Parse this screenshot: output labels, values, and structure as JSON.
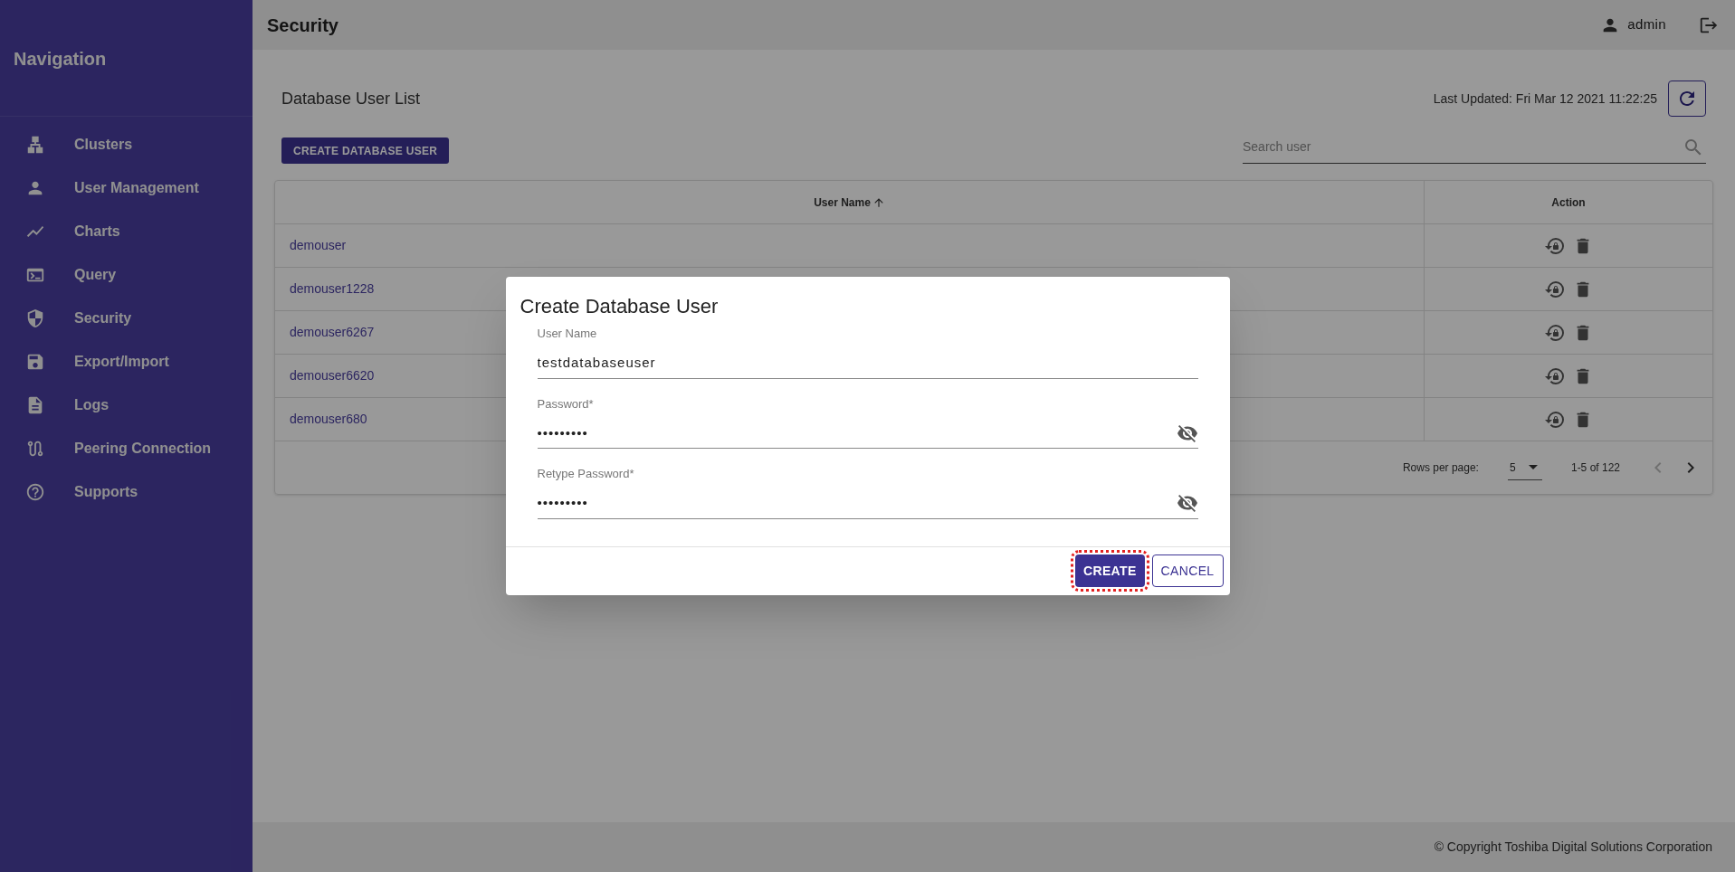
{
  "sidebar": {
    "title": "Navigation",
    "items": [
      {
        "label": "Clusters"
      },
      {
        "label": "User Management"
      },
      {
        "label": "Charts"
      },
      {
        "label": "Query"
      },
      {
        "label": "Security"
      },
      {
        "label": "Export/Import"
      },
      {
        "label": "Logs"
      },
      {
        "label": "Peering Connection"
      },
      {
        "label": "Supports"
      }
    ]
  },
  "header": {
    "title": "Security",
    "user": "admin"
  },
  "page": {
    "title": "Database User List",
    "last_updated": "Last Updated: Fri Mar 12 2021 11:22:25",
    "create_button": "CREATE DATABASE USER",
    "search": {
      "placeholder": "Search user"
    }
  },
  "table": {
    "columns": [
      {
        "label": "User Name",
        "sorted": true
      },
      {
        "label": "Action",
        "sorted": false
      }
    ],
    "rows": [
      {
        "name": "demouser"
      },
      {
        "name": "demouser1228"
      },
      {
        "name": "demouser6267"
      },
      {
        "name": "demouser6620"
      },
      {
        "name": "demouser680"
      }
    ],
    "pagination": {
      "rows_per_page_label": "Rows per page:",
      "rows_per_page": "5",
      "range": "1-5 of 122",
      "prev_disabled": true,
      "next_disabled": false
    }
  },
  "dialog": {
    "title": "Create Database User",
    "fields": [
      {
        "kind": "text",
        "label": "User Name",
        "value": "testdatabaseuser"
      },
      {
        "kind": "password",
        "label": "Password*",
        "value": "•••••••••"
      },
      {
        "kind": "password",
        "label": "Retype Password*",
        "value": "•••••••••"
      }
    ],
    "buttons": [
      {
        "kind": "primary",
        "label": "CREATE",
        "focused": true
      },
      {
        "kind": "outlined",
        "label": "CANCEL",
        "focused": false
      }
    ]
  },
  "footer": "© Copyright Toshiba Digital Solutions Corporation"
}
